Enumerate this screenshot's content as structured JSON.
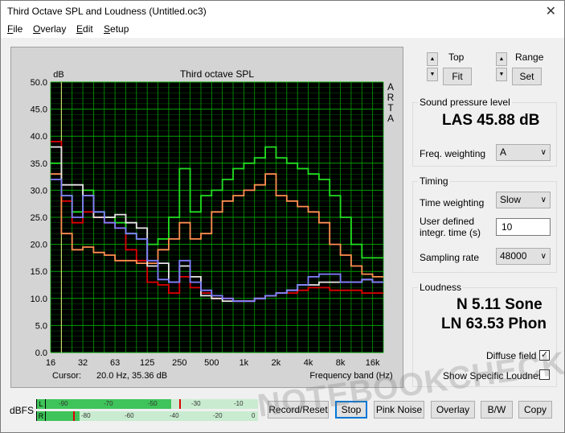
{
  "window": {
    "title": "Third Octave SPL and Loudness (Untitled.oc3)"
  },
  "menu": [
    {
      "accel": "F",
      "rest": "ile"
    },
    {
      "accel": "O",
      "rest": "verlay"
    },
    {
      "accel": "E",
      "rest": "dit"
    },
    {
      "accel": "S",
      "rest": "etup"
    }
  ],
  "plot": {
    "side_text": [
      "A",
      "R",
      "T",
      "A"
    ],
    "cursor_label": "Cursor:",
    "cursor_value": "20.0 Hz, 35.36 dB"
  },
  "chart_data": {
    "type": "line",
    "title": "Third octave SPL",
    "ylabel": "dB",
    "xlabel": "Frequency band (Hz)",
    "ylim": [
      0,
      50
    ],
    "yticks": [
      "0.0",
      "5.0",
      "10.0",
      "15.0",
      "20.0",
      "25.0",
      "30.0",
      "35.0",
      "40.0",
      "45.0",
      "50.0"
    ],
    "x_bands": [
      "16",
      "20",
      "25",
      "31.5",
      "40",
      "50",
      "63",
      "80",
      "100",
      "125",
      "160",
      "200",
      "250",
      "315",
      "400",
      "500",
      "630",
      "800",
      "1k",
      "1.25k",
      "1.6k",
      "2k",
      "2.5k",
      "3.15k",
      "4k",
      "5k",
      "6.3k",
      "8k",
      "10k",
      "12.5k",
      "16k",
      "20k"
    ],
    "x_tick_labels": [
      "16",
      "32",
      "63",
      "125",
      "250",
      "500",
      "1k",
      "2k",
      "4k",
      "8k",
      "16k"
    ],
    "series": [
      {
        "color": "#e00000",
        "values": [
          39.0,
          28.0,
          24.0,
          26.0,
          25.0,
          24.0,
          23.0,
          19.0,
          17.0,
          13.0,
          12.5,
          11.0,
          14.0,
          12.0,
          11.0,
          10.0,
          10.0,
          9.5,
          9.5,
          10.0,
          10.5,
          11.0,
          11.0,
          11.5,
          12.0,
          12.0,
          11.5,
          11.5,
          11.5,
          11.0,
          11.0
        ]
      },
      {
        "color": "#20e020",
        "values": [
          35.0,
          29.0,
          26.0,
          30.0,
          26.0,
          25.0,
          24.0,
          22.0,
          21.0,
          20.0,
          21.0,
          25.0,
          34.0,
          26.0,
          29.0,
          30.0,
          32.0,
          34.0,
          35.0,
          36.0,
          38.0,
          36.0,
          35.0,
          34.0,
          33.0,
          32.0,
          29.0,
          25.0,
          20.0,
          17.5,
          17.5
        ]
      },
      {
        "color": "#ff9050",
        "values": [
          33.0,
          22.0,
          19.0,
          19.5,
          18.5,
          18.0,
          17.0,
          17.0,
          16.5,
          16.5,
          19.0,
          21.0,
          24.0,
          21.0,
          22.0,
          26.0,
          28.0,
          29.0,
          30.0,
          31.0,
          33.0,
          29.0,
          28.0,
          27.0,
          26.0,
          24.0,
          20.0,
          18.0,
          16.0,
          14.5,
          14.0
        ]
      },
      {
        "color": "#e8e8e8",
        "values": [
          38.0,
          31.0,
          31.0,
          29.0,
          25.0,
          25.0,
          25.5,
          24.0,
          23.0,
          16.0,
          16.5,
          13.0,
          16.0,
          14.0,
          10.5,
          10.0,
          9.5,
          9.5,
          9.5,
          10.0,
          10.5,
          11.0,
          11.5,
          12.5,
          12.5,
          13.0,
          13.0,
          13.0,
          13.0,
          13.5,
          13.0
        ]
      },
      {
        "color": "#8080ff",
        "values": [
          32.0,
          29.0,
          25.0,
          29.0,
          26.0,
          24.0,
          23.0,
          22.0,
          21.0,
          17.0,
          13.5,
          13.0,
          17.0,
          13.0,
          11.5,
          10.5,
          10.0,
          9.5,
          9.5,
          10.0,
          10.5,
          11.0,
          11.5,
          12.5,
          14.0,
          14.5,
          14.5,
          13.0,
          13.0,
          13.5,
          13.0
        ]
      }
    ],
    "grid": true,
    "background": "#000000",
    "grid_color": "#00a000"
  },
  "controls": {
    "top_label": "Top",
    "range_label": "Range",
    "fit_label": "Fit",
    "set_label": "Set",
    "spl_group": "Sound pressure level",
    "spl_value": "LAS 45.88 dB",
    "freq_weighting_label": "Freq. weighting",
    "freq_weighting_value": "A",
    "timing_group": "Timing",
    "time_weighting_label": "Time weighting",
    "time_weighting_value": "Slow",
    "user_time_label_1": "User defined",
    "user_time_label_2": "integr. time (s)",
    "user_time_value": "10",
    "sampling_rate_label": "Sampling rate",
    "sampling_rate_value": "48000",
    "loudness_group": "Loudness",
    "sone_value": "N 5.11 Sone",
    "phon_value": "LN 63.53 Phon",
    "diffuse_field_label": "Diffuse field",
    "show_specific_label": "Show Specific Loudness"
  },
  "bottom": {
    "dbfs_label": "dBFS",
    "meter_L": "L",
    "meter_R": "R",
    "ticks_L": [
      "-90",
      "-70",
      "-50",
      "-30",
      "-10"
    ],
    "ticks_R": [
      "-80",
      "-60",
      "-40",
      "-20",
      "0"
    ],
    "level_L": 0.59,
    "level_R": 0.16,
    "buttons": [
      "Record/Reset",
      "Stop",
      "Pink Noise",
      "Overlay",
      "B/W",
      "Copy"
    ]
  },
  "watermark": "NOTEBOOKCHECK"
}
